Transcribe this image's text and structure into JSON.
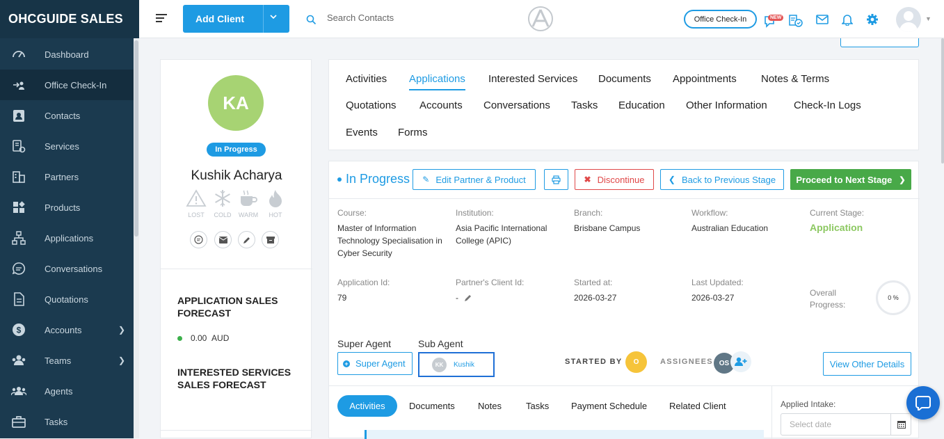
{
  "brand": "OHCGUIDE SALES",
  "sidebar": {
    "items": [
      {
        "label": "Dashboard",
        "icon": "gauge-icon"
      },
      {
        "label": "Office Check-In",
        "icon": "checkin-icon"
      },
      {
        "label": "Contacts",
        "icon": "contact-card-icon"
      },
      {
        "label": "Services",
        "icon": "services-icon"
      },
      {
        "label": "Partners",
        "icon": "building-icon"
      },
      {
        "label": "Products",
        "icon": "products-icon"
      },
      {
        "label": "Applications",
        "icon": "workflow-icon"
      },
      {
        "label": "Conversations",
        "icon": "chat-icon"
      },
      {
        "label": "Quotations",
        "icon": "document-icon"
      },
      {
        "label": "Accounts",
        "icon": "dollar-icon"
      },
      {
        "label": "Teams",
        "icon": "team-icon"
      },
      {
        "label": "Agents",
        "icon": "agents-icon"
      },
      {
        "label": "Tasks",
        "icon": "briefcase-icon"
      }
    ],
    "active_index": 1
  },
  "topbar": {
    "add_client": "Add Client",
    "search_placeholder": "Search Contacts",
    "office_checkin": "Office Check-In",
    "new_badge": "NEW"
  },
  "profile": {
    "initials": "KA",
    "status": "In Progress",
    "name": "Kushik Acharya",
    "temps": [
      "LOST",
      "COLD",
      "WARM",
      "HOT"
    ],
    "app_forecast_title": "APPLICATION SALES FORECAST",
    "app_forecast_amount": "0.00",
    "app_forecast_currency": "AUD",
    "services_forecast_title": "INTERESTED SERVICES SALES FORECAST"
  },
  "tabs": [
    "Activities",
    "Applications",
    "Interested Services",
    "Documents",
    "Appointments",
    "Notes & Terms",
    "Quotations",
    "Accounts",
    "Conversations",
    "Tasks",
    "Education",
    "Other Information",
    "Check-In Logs",
    "Events",
    "Forms"
  ],
  "active_tab": "Applications",
  "application": {
    "stage_title": "In Progress",
    "buttons": {
      "edit": "Edit Partner & Product",
      "discontinue": "Discontinue",
      "back": "Back to Previous Stage",
      "next": "Proceed to Next Stage"
    },
    "fields": {
      "course_label": "Course:",
      "course_value": "Master of Information Technology Specialisation in Cyber Security",
      "institution_label": "Institution:",
      "institution_value": "Asia Pacific International College (APIC)",
      "branch_label": "Branch:",
      "branch_value": "Brisbane Campus",
      "workflow_label": "Workflow:",
      "workflow_value": "Australian Education",
      "current_stage_label": "Current Stage:",
      "current_stage_value": "Application",
      "app_id_label": "Application Id:",
      "app_id_value": "79",
      "partner_client_label": "Partner's Client Id:",
      "partner_client_value": "-",
      "started_label": "Started at:",
      "started_value": "2026-03-27",
      "updated_label": "Last Updated:",
      "updated_value": "2026-03-27",
      "overall_label": "Overall Progress:",
      "overall_value": "0 %"
    },
    "super_agent_label": "Super Agent",
    "sub_agent_label": "Sub Agent",
    "super_agent_button": "Super Agent",
    "sub_agent_initials": "KK",
    "sub_agent_name": "Kushik",
    "started_by_label": "STARTED BY",
    "started_by_initial": "O",
    "assignees_label": "ASSIGNEES",
    "assignee_initials": "OS",
    "view_other": "View Other Details",
    "subtabs": [
      "Activities",
      "Documents",
      "Notes",
      "Tasks",
      "Payment Schedule",
      "Related Client"
    ],
    "applied_intake_label": "Applied Intake:",
    "date_placeholder": "Select date"
  },
  "colors": {
    "sidebar": "#1b3a4f",
    "accent": "#1e9be3",
    "success": "#48a948",
    "danger": "#e04848",
    "avatar": "#a7d373"
  }
}
